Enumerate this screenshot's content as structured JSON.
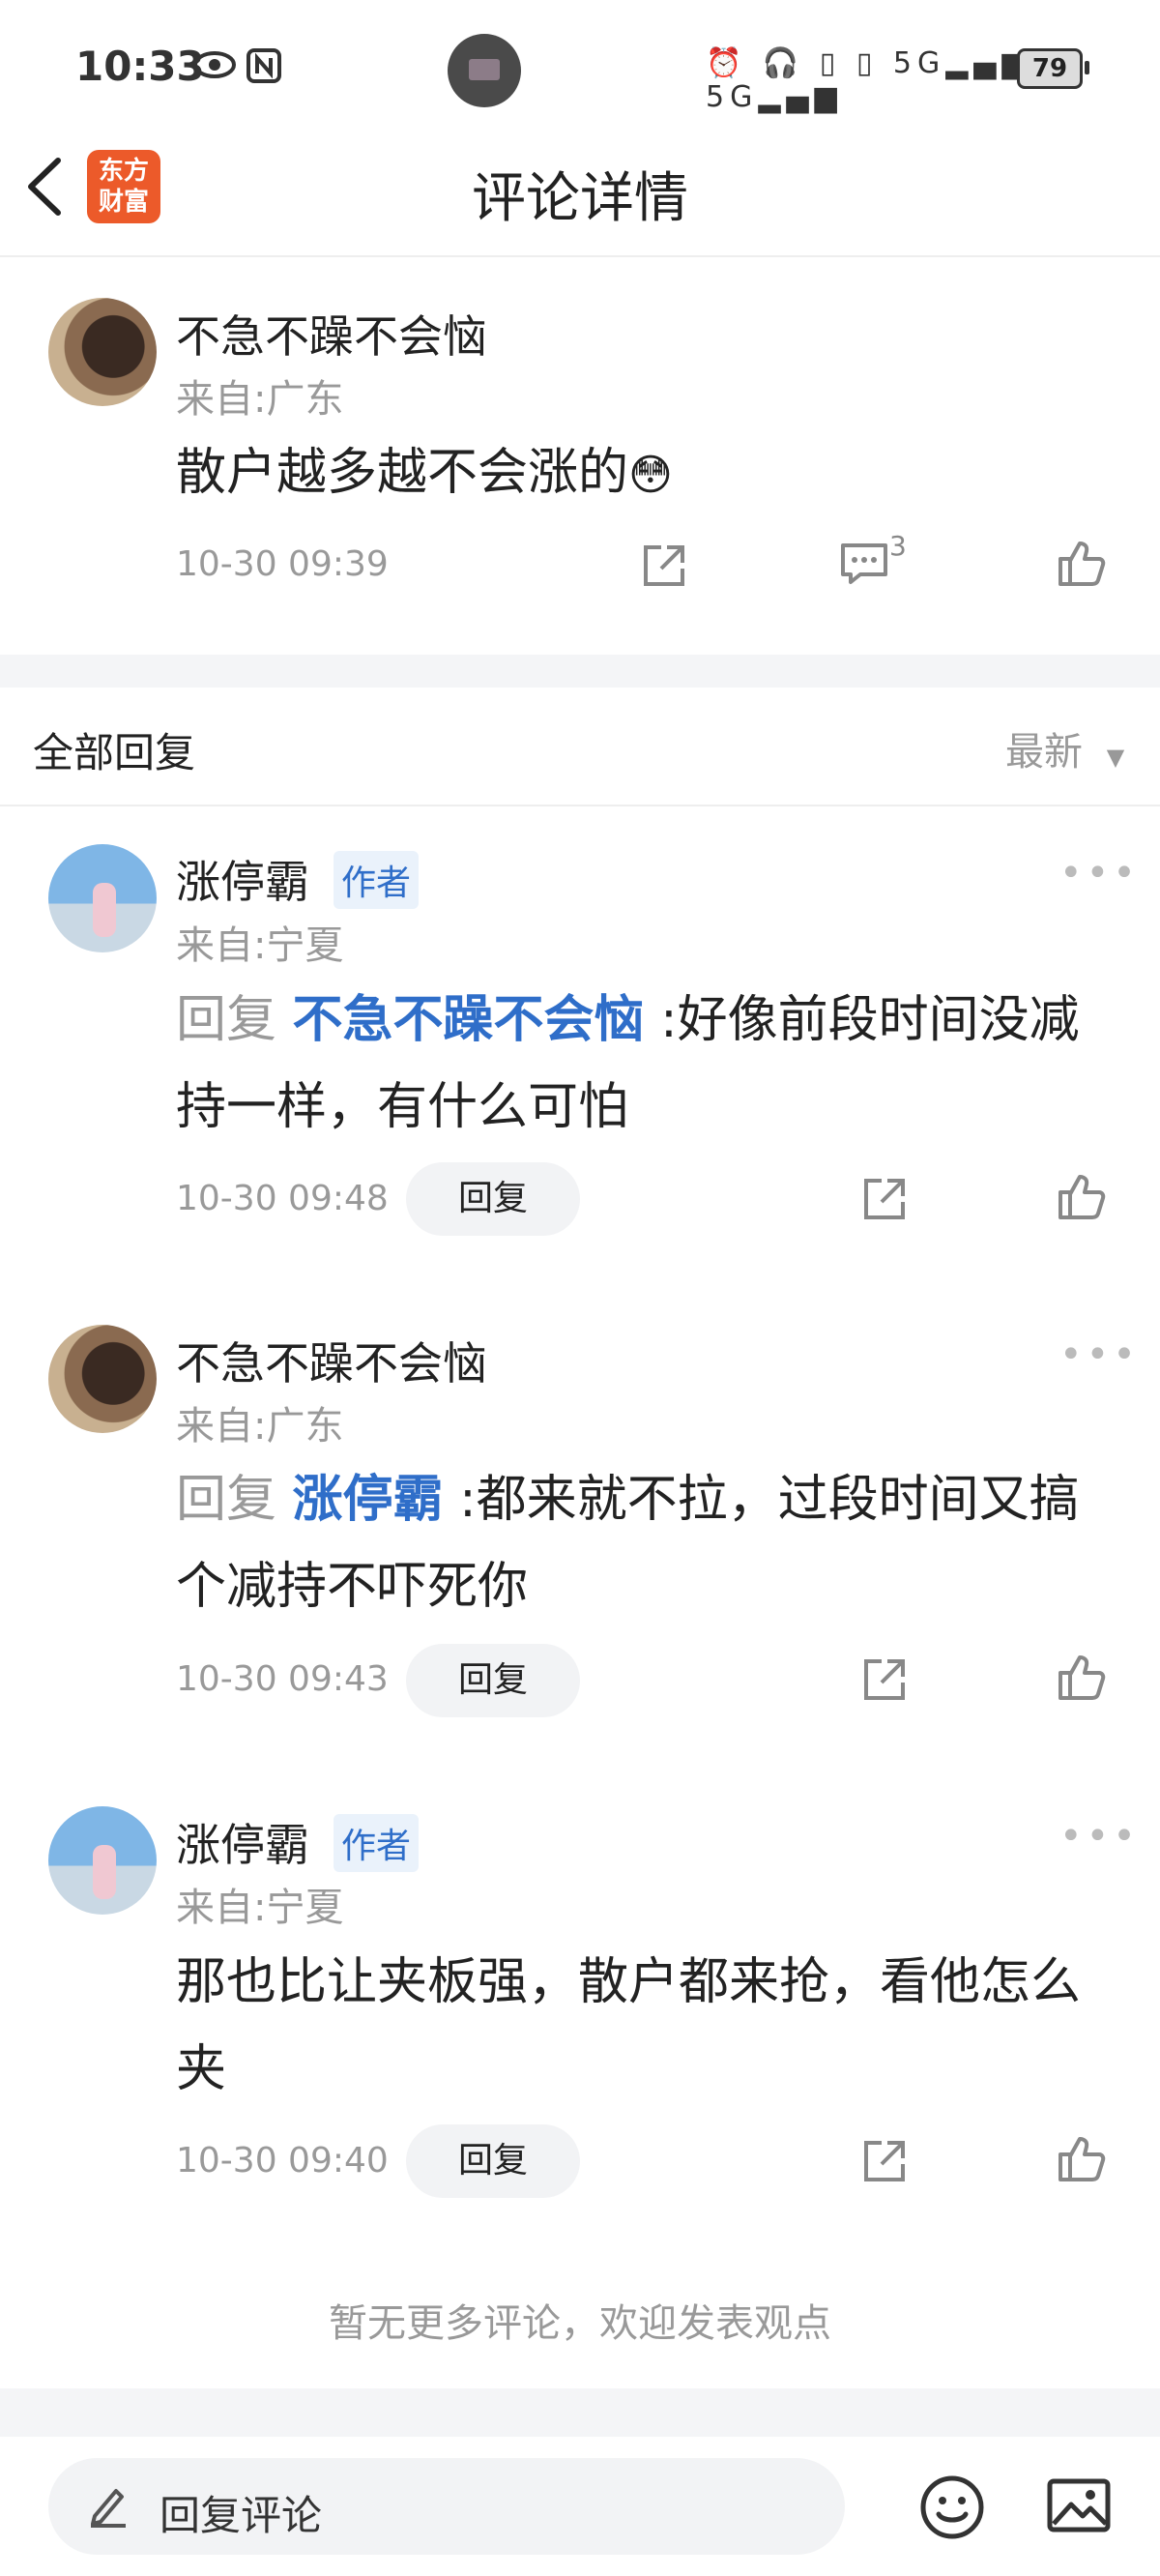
{
  "status_bar": {
    "time": "10:33",
    "indicators": "⏰ 🎧 ▯ ▯ 5G▂▄▆ 5G▂▄▆",
    "battery": "79"
  },
  "header": {
    "logo_text": "东方财富",
    "title": "评论详情"
  },
  "main_comment": {
    "user": "不急不躁不会恼",
    "location": "来自:广东",
    "text": "散户越多越不会涨的",
    "emoji": "😳",
    "time": "10-30 09:39",
    "comment_count": "3"
  },
  "replies_section": {
    "title": "全部回复",
    "sort_label": "最新",
    "reply_prefix": "回复",
    "reply_button": "回复",
    "author_tag": "作者"
  },
  "replies": [
    {
      "user": "涨停霸",
      "location": "来自:宁夏",
      "reply_to": "不急不躁不会恼",
      "text": "好像前段时间没减持一样，有什么可怕",
      "time": "10-30 09:48",
      "is_author": true
    },
    {
      "user": "不急不躁不会恼",
      "location": "来自:广东",
      "reply_to": "涨停霸",
      "text": "都来就不拉，过段时间又搞个减持不吓死你",
      "time": "10-30 09:43",
      "is_author": false
    },
    {
      "user": "涨停霸",
      "location": "来自:宁夏",
      "reply_to": "",
      "text": "那也比让夹板强，散户都来抢，看他怎么夹",
      "time": "10-30 09:40",
      "is_author": true
    }
  ],
  "end_note": "暂无更多评论，欢迎发表观点",
  "bottom_bar": {
    "input_placeholder": "回复评论"
  },
  "icons": {
    "back": "chevron-left",
    "share": "share-icon",
    "comment": "comment-icon",
    "like": "thumbs-up-icon",
    "edit": "pencil-icon",
    "emoji": "smiley-icon",
    "image": "image-icon"
  },
  "colors": {
    "accent": "#2f6ec9",
    "logo": "#ec5a2a"
  }
}
